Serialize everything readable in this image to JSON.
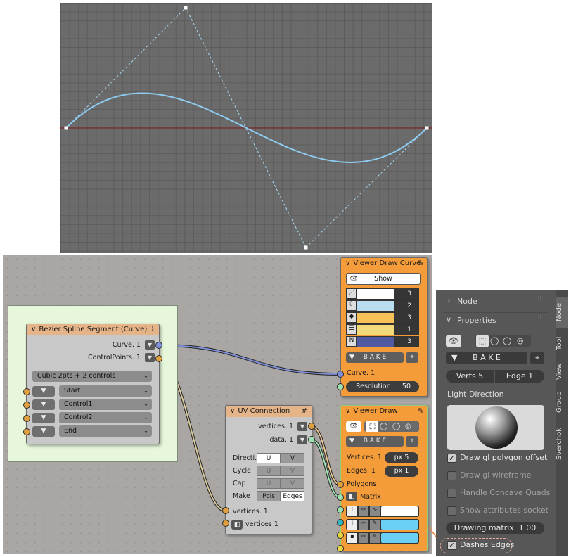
{
  "viewport": {
    "label": "3D viewport curve preview"
  },
  "bezier_node": {
    "title": "Bezier Spline Segment (Curve)",
    "out_curve": "Curve. 1",
    "out_controlpoints": "ControlPoints. 1",
    "mode": "Cubic 2pts + 2 controls",
    "inputs": [
      "Start",
      "Control1",
      "Control2",
      "End"
    ]
  },
  "vdc_node": {
    "title": "Viewer Draw Curve",
    "show_label": "Show",
    "rows": [
      "3",
      "2",
      "3",
      "1",
      "3"
    ],
    "bake_label": "B A K E",
    "in_curve": "Curve. 1",
    "resolution_label": "Resolution",
    "resolution_value": "50",
    "colors": [
      "#ffffff",
      "#b9dcf0",
      "#f7c25a",
      "#f2d97a",
      "#4f5aa0"
    ]
  },
  "uv_node": {
    "title": "UV Connection",
    "out_vertices": "vertices. 1",
    "out_data": "data. 1",
    "rows": [
      {
        "label": "Directi...",
        "u": "U",
        "v": "V"
      },
      {
        "label": "Cycle",
        "u": "U",
        "v": "V"
      },
      {
        "label": "Cap",
        "u": "U",
        "v": "V"
      },
      {
        "label": "Make",
        "u": "Pols",
        "v": "Edges"
      }
    ],
    "in_vertices": "vertices. 1",
    "in_vertices_nested": "vertices 1"
  },
  "vd_node": {
    "title": "Viewer Draw",
    "bake_label": "B A K E",
    "in_vertices": "Vertices. 1",
    "vert_px": "px  5",
    "in_edges": "Edges. 1",
    "edge_px": "px  1",
    "in_polygons": "Polygons",
    "in_matrix": "Matrix",
    "colors": [
      "#ffffff",
      "#6cd0f6",
      "#6cd0f6"
    ]
  },
  "side_panel": {
    "node_section": "Node",
    "properties_section": "Properties",
    "bake_label": "B A K E",
    "verts_label": "Verts",
    "verts_value": "5",
    "edge_label": "Edge",
    "edge_value": "1",
    "light_direction": "Light Direction",
    "checks": [
      {
        "label": "Draw gl polygon offset",
        "checked": true
      },
      {
        "label": "Draw gl wireframe",
        "checked": false
      },
      {
        "label": "Handle Concave Quads",
        "checked": false
      },
      {
        "label": "Show attributes socket",
        "checked": false
      }
    ],
    "drawing_matrix_label": "Drawing matrix",
    "drawing_matrix_value": "1.00",
    "dashes_edges": "Dashes Edges",
    "tabs": [
      "Node",
      "Tool",
      "View",
      "Group",
      "Sverchok"
    ]
  }
}
